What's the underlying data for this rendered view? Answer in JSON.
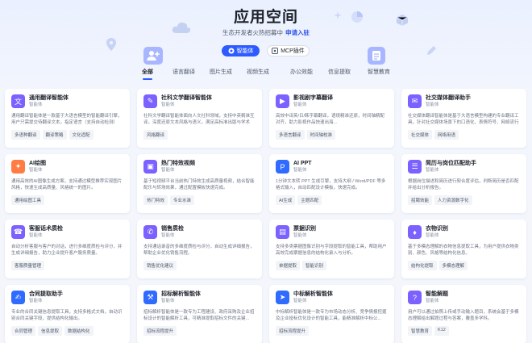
{
  "header": {
    "title": "应用空间",
    "subtitle": "生态开发者火热招募中",
    "subtitle_link": "申请入驻"
  },
  "toggle": {
    "agent_label": "智能体",
    "mcp_label": "MCP插件"
  },
  "tabs": [
    "全部",
    "语言翻译",
    "图片生成",
    "视频生成",
    "办公效能",
    "信息提取",
    "智慧教育"
  ],
  "cards": [
    {
      "title": "通用翻译智能体",
      "type": "智能体",
      "desc": "通用翻译智能体是一款基于大语言模型的智能翻译引擎，用户只需提交待翻译文本，指定语言（支持自动检测）即...",
      "tags": [
        "多语种翻译",
        "翻译策略",
        "文化适配"
      ],
      "icon": "doc-icon",
      "color": "#7b61ff"
    },
    {
      "title": "社科文学翻译智能体",
      "type": "智能体",
      "desc": "社科文学翻译智能体面向人文社科领域，支持中英精准互译，深度还原文本风格与语义，满足高标准出版与学术翻...",
      "tags": [
        "风格翻译"
      ],
      "icon": "book-icon",
      "color": "#7b61ff"
    },
    {
      "title": "影视剧字幕翻译",
      "type": "智能体",
      "desc": "高效中译英/日/韩字幕翻译，语境精准还原，时间轴精配对齐，助力影视作品快速出海...",
      "tags": [
        "多语言翻译",
        "时间轴校准"
      ],
      "icon": "video-icon",
      "color": "#7b61ff"
    },
    {
      "title": "社交媒体翻译助手",
      "type": "智能体",
      "desc": "社交媒体翻译智能体是基于大语言模型构建的专业翻译工具，针对社交媒体场景下的口语化、表情符号、网络流行语...",
      "tags": [
        "社交媒体",
        "网络用语"
      ],
      "icon": "chat-icon",
      "color": "#7b61ff"
    },
    {
      "title": "AI绘图",
      "type": "智能体",
      "desc": "通用高效的AI图像生成方案，支持通过模型推荐实现图片风格，快速生成高质量、风格统一的图片。",
      "tags": [
        "通用绘图工具"
      ],
      "icon": "brush-icon",
      "color": "#ff7d45"
    },
    {
      "title": "热门特效视频",
      "type": "智能体",
      "desc": "基于短视频平台当前热门特效生成高质量视频，结合智能配乐与转场效果，通过配置模板快速完成。",
      "tags": [
        "热门特效",
        "专业水准"
      ],
      "icon": "film-icon",
      "color": "#7b61ff"
    },
    {
      "title": "AI PPT",
      "type": "智能体",
      "desc": "1分钟文本转 PPT 生成引擎，支持大纲 / Word/PDF 等多格式输入，自动匹配设计模板，快速完成。",
      "tags": [
        "AI生成",
        "主题匹配"
      ],
      "icon": "ppt-icon",
      "color": "#2f6bff"
    },
    {
      "title": "简历与岗位匹配助手",
      "type": "智能体",
      "desc": "根据岗位描述和简历进行契合度评估，判断简历是否匹配并给出分析报告。",
      "tags": [
        "招聘效能",
        "人力资源数字化"
      ],
      "icon": "resume-icon",
      "color": "#7b61ff"
    },
    {
      "title": "客服话术质检",
      "type": "智能体",
      "desc": "自动分析客服与客户的对话，进行多维度质检与评分，并生成详细报告，助力企业提升客户服务质量。",
      "tags": [
        "客服质量管理"
      ],
      "icon": "headset-icon",
      "color": "#7b61ff"
    },
    {
      "title": "销售质检",
      "type": "智能体",
      "desc": "支持通话录音的多维度质检与评分，自动生成详细报告，帮助企业优化销售流程。",
      "tags": [
        "销售优化建议"
      ],
      "icon": "phone-icon",
      "color": "#7b61ff"
    },
    {
      "title": "票据识别",
      "type": "智能体",
      "desc": "支持多类票据图像识别与字段提取的智能工具，帮助用户高效完成票据信息的结构化录入与分析。",
      "tags": [
        "单据提取",
        "智能识别"
      ],
      "icon": "receipt-icon",
      "color": "#7b61ff"
    },
    {
      "title": "衣物识别",
      "type": "智能体",
      "desc": "基于多模态理解的衣物信息提取工具，为用户提供衣物类别、颜色、风格等结构化信息。",
      "tags": [
        "结构化提取",
        "多模态理解"
      ],
      "icon": "shirt-icon",
      "color": "#7b61ff"
    },
    {
      "title": "合同提取助手",
      "type": "智能体",
      "desc": "专业的合同关键信息提取工具，支持多格式文档，自动识别合同关键字段，提供结构化输出。",
      "tags": [
        "合同管理",
        "信息提取",
        "数据结构化"
      ],
      "icon": "contract-icon",
      "color": "#2f6bff"
    },
    {
      "title": "招标解析智能体",
      "type": "智能体",
      "desc": "招标解析智能体是一款专为工程建设、政府采购及企业招标设计的智能解析工具，可精准提取招标文件的关键...",
      "tags": [
        "招标流程提升"
      ],
      "icon": "hammer-icon",
      "color": "#2f6bff"
    },
    {
      "title": "中标解析智能体",
      "type": "智能体",
      "desc": "中标解析智能体是一款专为市场动态分析、竞争情报挖掘及企业投标优化设计的智能工具，能精准解析中标公...",
      "tags": [
        "招标流程提升"
      ],
      "icon": "send-icon",
      "color": "#2f6bff"
    },
    {
      "title": "智能解题",
      "type": "智能体",
      "desc": "用户可以通过拍照上传或手动输入题目，系统会基于多模态理解给出解题过程与答案，覆盖多学科。",
      "tags": [
        "智慧教育",
        "K12"
      ],
      "icon": "quiz-icon",
      "color": "#7b61ff"
    }
  ]
}
